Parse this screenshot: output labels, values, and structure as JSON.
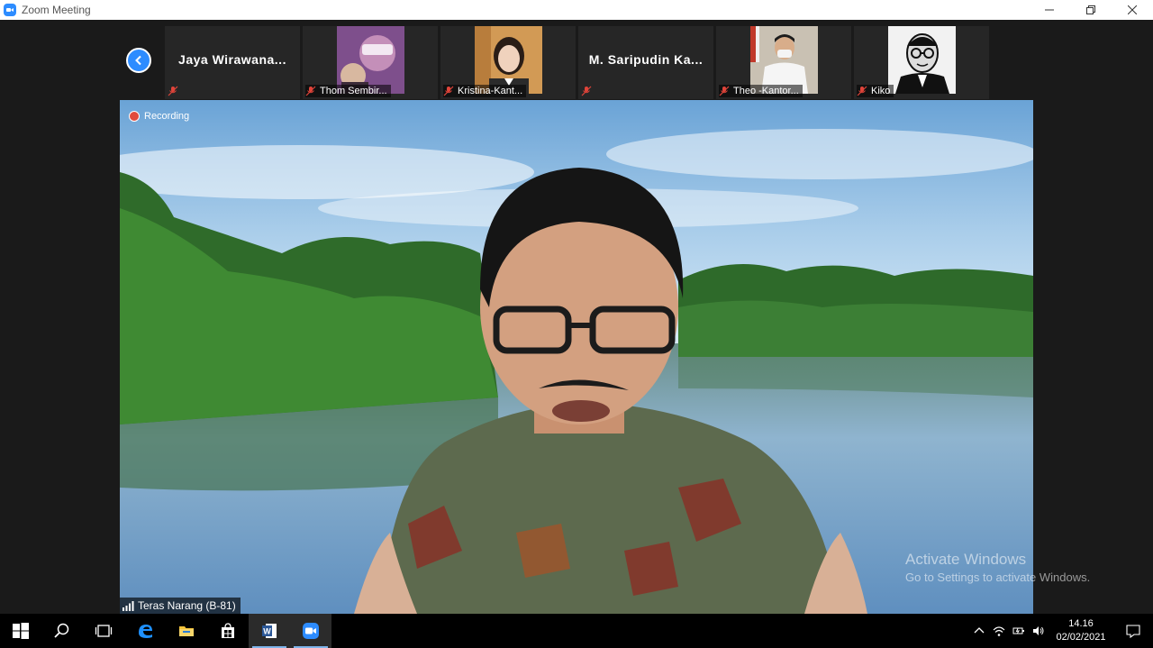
{
  "window": {
    "title": "Zoom Meeting"
  },
  "participants": [
    {
      "name": "Jaya  Wirawana...",
      "display": "text"
    },
    {
      "name": "Thom Sembir...",
      "display": "video"
    },
    {
      "name": "Kristina-Kant...",
      "display": "video"
    },
    {
      "name": "M.  Saripudin  Ka...",
      "display": "text"
    },
    {
      "name": "Theo -Kantor...",
      "display": "video"
    },
    {
      "name": "Kiko",
      "display": "video"
    }
  ],
  "main": {
    "recording_label": "Recording",
    "speaker_name": "Teras Narang (B-81)"
  },
  "watermark": {
    "line1": "Activate Windows",
    "line2": "Go to Settings to activate Windows."
  },
  "taskbar": {
    "apps": [
      "windows-start",
      "search",
      "task-view",
      "edge",
      "file-explorer",
      "store",
      "word",
      "zoom"
    ],
    "time": "14.16",
    "date": "02/02/2021"
  },
  "colors": {
    "accent": "#2d8cff",
    "recording": "#e04b3c",
    "muted": "#e0443a"
  }
}
